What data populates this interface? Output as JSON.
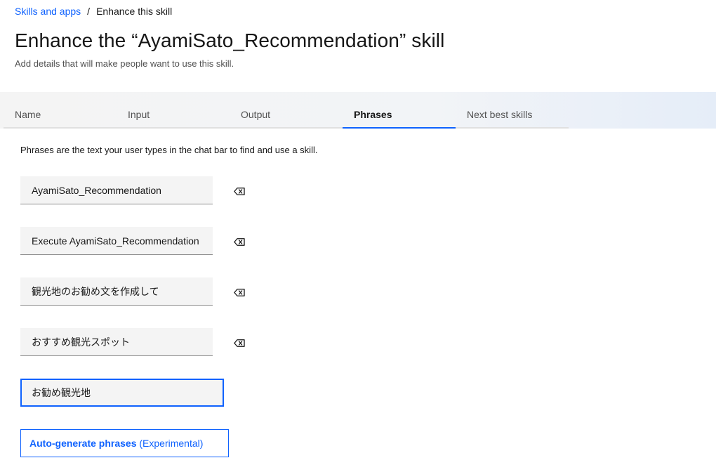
{
  "breadcrumb": {
    "parent": "Skills and apps",
    "separator": "/",
    "current": "Enhance this skill"
  },
  "header": {
    "title": "Enhance the “AyamiSato_Recommendation” skill",
    "subtitle": "Add details that will make people want to use this skill."
  },
  "tabs": [
    {
      "label": "Name",
      "active": false
    },
    {
      "label": "Input",
      "active": false
    },
    {
      "label": "Output",
      "active": false
    },
    {
      "label": "Phrases",
      "active": true
    },
    {
      "label": "Next best skills",
      "active": false
    }
  ],
  "phrases_panel": {
    "description": "Phrases are the text your user types in the chat bar to find and use a skill.",
    "phrases": [
      {
        "value": "AyamiSato_Recommendation",
        "delete_icon": "backspace-delete-icon"
      },
      {
        "value": "Execute AyamiSato_Recommendation",
        "delete_icon": "backspace-delete-icon"
      },
      {
        "value": "観光地のお勧め文を作成して",
        "delete_icon": "backspace-delete-icon"
      },
      {
        "value": "おすすめ観光スポット",
        "delete_icon": "backspace-delete-icon"
      }
    ],
    "new_phrase_value": "お勧め観光地",
    "autogen_button": {
      "label": "Auto-generate phrases",
      "suffix": " (Experimental)"
    }
  },
  "colors": {
    "accent": "#0f62fe",
    "text": "#161616",
    "field_bg": "#f4f4f4"
  }
}
